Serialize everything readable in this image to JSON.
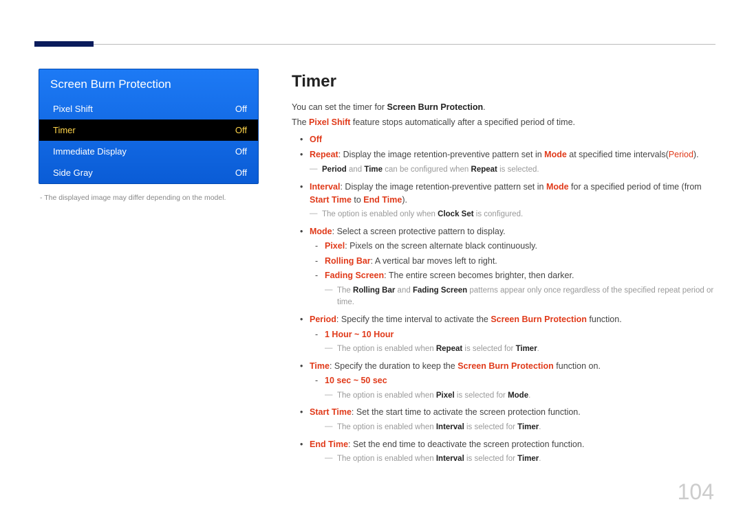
{
  "page_number": "104",
  "menu": {
    "title": "Screen Burn Protection",
    "items": [
      {
        "label": "Pixel Shift",
        "value": "Off"
      },
      {
        "label": "Timer",
        "value": "Off"
      },
      {
        "label": "Immediate Display",
        "value": "Off"
      },
      {
        "label": "Side Gray",
        "value": "Off"
      }
    ]
  },
  "footnote": "The displayed image may differ depending on the model.",
  "content": {
    "heading": "Timer",
    "intro1_a": "You can set the timer for ",
    "intro1_b": "Screen Burn Protection",
    "intro1_c": ".",
    "intro2_a": "The ",
    "intro2_b": "Pixel Shift",
    "intro2_c": " feature stops automatically after a specified period of time.",
    "off": "Off",
    "repeat_a": "Repeat",
    "repeat_b": ": Display the image retention-preventive pattern set in ",
    "repeat_c": "Mode",
    "repeat_d": " at specified time intervals(",
    "repeat_e": "Period",
    "repeat_f": ").",
    "note1_a": "Period",
    "note1_b": " and ",
    "note1_c": "Time",
    "note1_d": " can be configured when ",
    "note1_e": "Repeat",
    "note1_f": " is selected.",
    "interval_a": "Interval",
    "interval_b": ": Display the image retention-preventive pattern set in ",
    "interval_c": "Mode",
    "interval_d": " for a specified period of time (from ",
    "interval_e": "Start Time",
    "interval_f": " to ",
    "interval_g": "End Time",
    "interval_h": ").",
    "note2_a": "The option is enabled only when ",
    "note2_b": "Clock Set",
    "note2_c": " is configured.",
    "mode_a": "Mode",
    "mode_b": ": Select a screen protective pattern to display.",
    "pixel_a": "Pixel",
    "pixel_b": ": Pixels on the screen alternate black continuously.",
    "rolling_a": "Rolling Bar",
    "rolling_b": ": A vertical bar moves left to right.",
    "fading_a": "Fading Screen",
    "fading_b": ": The entire screen becomes brighter, then darker.",
    "note3_a": "The ",
    "note3_b": "Rolling Bar",
    "note3_c": " and ",
    "note3_d": "Fading Screen",
    "note3_e": " patterns appear only once regardless of the specified repeat period or time.",
    "period_a": "Period",
    "period_b": ": Specify the time interval to activate the ",
    "period_c": "Screen Burn Protection",
    "period_d": " function.",
    "period_range": "1 Hour ~ 10 Hour",
    "note4_a": "The option is enabled when ",
    "note4_b": "Repeat",
    "note4_c": " is selected for ",
    "note4_d": "Timer",
    "note4_e": ".",
    "time_a": "Time",
    "time_b": ": Specify the duration to keep the ",
    "time_c": "Screen Burn Protection",
    "time_d": " function on.",
    "time_range": "10 sec ~ 50 sec",
    "note5_a": "The option is enabled when ",
    "note5_b": "Pixel",
    "note5_c": " is selected for ",
    "note5_d": "Mode",
    "note5_e": ".",
    "start_a": "Start Time",
    "start_b": ": Set the start time to activate the screen protection function.",
    "note6_a": "The option is enabled when ",
    "note6_b": "Interval",
    "note6_c": " is selected for ",
    "note6_d": "Timer",
    "note6_e": ".",
    "end_a": "End Time",
    "end_b": ": Set the end time to deactivate the screen protection function.",
    "note7_a": "The option is enabled when ",
    "note7_b": "Interval",
    "note7_c": " is selected for ",
    "note7_d": "Timer",
    "note7_e": "."
  }
}
